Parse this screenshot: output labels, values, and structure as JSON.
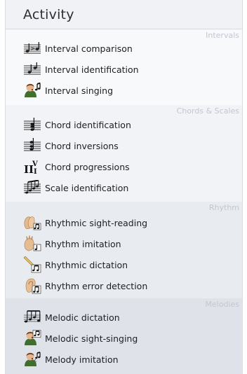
{
  "header": {
    "title": "Activity"
  },
  "sections": [
    {
      "title": "Intervals",
      "background": "#f8f9fa",
      "items": [
        {
          "label": "Interval comparison",
          "icon": "interval-comparison-icon"
        },
        {
          "label": "Interval identification",
          "icon": "interval-identification-icon"
        },
        {
          "label": "Interval singing",
          "icon": "singer-icon"
        }
      ]
    },
    {
      "title": "Chords & Scales",
      "background": "#f1f3f6",
      "items": [
        {
          "label": "Chord identification",
          "icon": "chord-identification-icon"
        },
        {
          "label": "Chord inversions",
          "icon": "chord-inversions-icon"
        },
        {
          "label": "Chord progressions",
          "icon": "chord-progressions-icon"
        },
        {
          "label": "Scale identification",
          "icon": "scale-identification-icon"
        }
      ]
    },
    {
      "title": "Rhythm",
      "background": "#e8ebef",
      "items": [
        {
          "label": "Rhythmic sight-reading",
          "icon": "clapping-hands-icon"
        },
        {
          "label": "Rhythm imitation",
          "icon": "tapping-hand-icon"
        },
        {
          "label": "Rhythmic dictation",
          "icon": "pencil-rhythm-icon"
        },
        {
          "label": "Rhythm error detection",
          "icon": "ear-rhythm-icon"
        }
      ]
    },
    {
      "title": "Melodies",
      "background": "#dfe3e9",
      "items": [
        {
          "label": "Melodic dictation",
          "icon": "melodic-dictation-icon"
        },
        {
          "label": "Melodic sight-singing",
          "icon": "singer-sight-icon"
        },
        {
          "label": "Melody imitation",
          "icon": "singer-imitation-icon"
        }
      ]
    }
  ]
}
